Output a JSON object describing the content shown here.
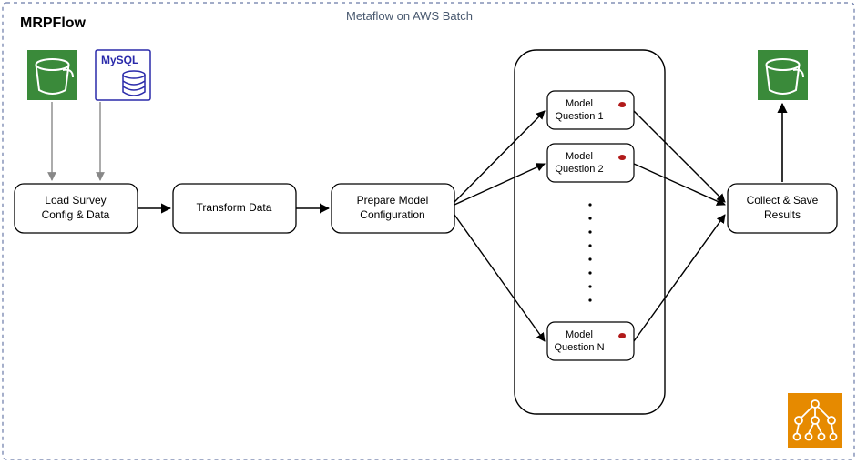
{
  "diagram": {
    "title": "MRPFlow",
    "subtitle": "Metaflow on AWS Batch",
    "sources": {
      "s3_left_label": "",
      "mysql_label": "MySQL"
    },
    "nodes": {
      "load": {
        "line1": "Load Survey",
        "line2": "Config & Data"
      },
      "transform": {
        "line1": "Transform Data"
      },
      "prepare": {
        "line1": "Prepare Model",
        "line2": "Configuration"
      },
      "model1": {
        "line1": "Model",
        "line2": "Question 1"
      },
      "model2": {
        "line1": "Model",
        "line2": "Question 2"
      },
      "modelN": {
        "line1": "Model",
        "line2": "Question N"
      },
      "collect": {
        "line1": "Collect & Save",
        "line2": "Results"
      }
    }
  }
}
